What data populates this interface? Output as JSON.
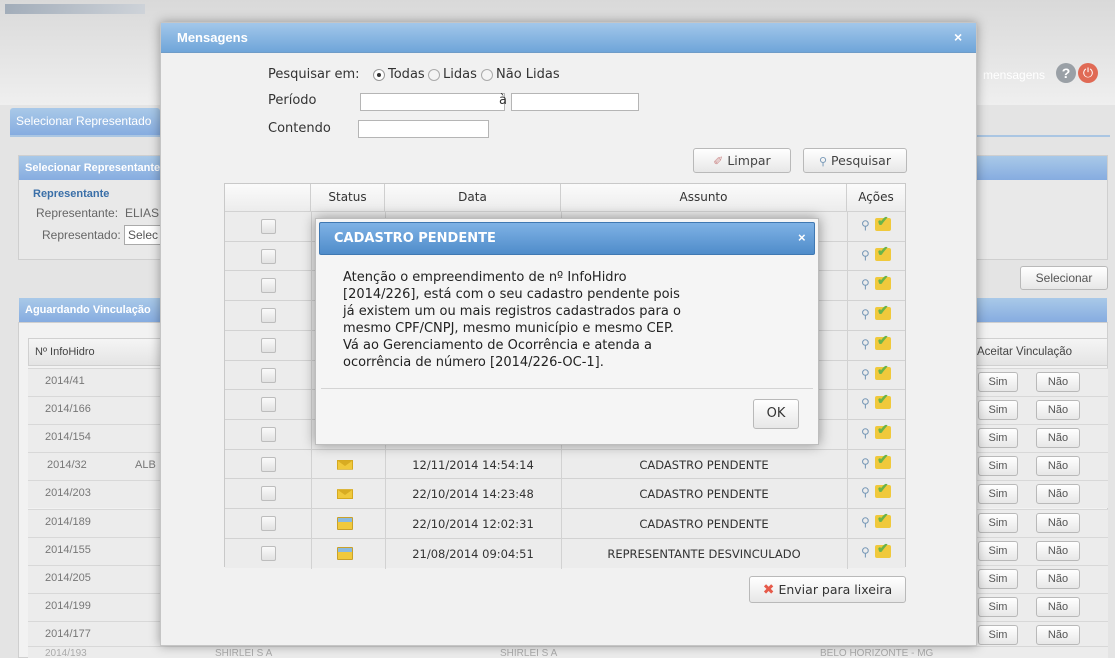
{
  "background": {
    "tab_select": "Selecionar Representado",
    "panel_select_title": "Selecionar Representante",
    "representante_heading": "Representante",
    "representante_label": "Representante:",
    "representante_value": "ELIAS",
    "representado_label": "Representado:",
    "representado_value": "Selec",
    "select_button": "Selecionar",
    "top_right_link": "mensagens",
    "panel_waiting_title": "Aguardando Vinculação",
    "col_infohidro": "Nº InfoHidro",
    "col_aceitar": "Aceitar Vinculação",
    "sim": "Sim",
    "nao": "Não",
    "rows": [
      {
        "id": "2014/41",
        "name": ""
      },
      {
        "id": "2014/166",
        "name": ""
      },
      {
        "id": "2014/154",
        "name": ""
      },
      {
        "id": "2014/32",
        "name": "ALB"
      },
      {
        "id": "2014/203",
        "name": ""
      },
      {
        "id": "2014/189",
        "name": ""
      },
      {
        "id": "2014/155",
        "name": ""
      },
      {
        "id": "2014/205",
        "name": ""
      },
      {
        "id": "2014/199",
        "name": ""
      },
      {
        "id": "2014/177",
        "name": ""
      }
    ],
    "last_row": {
      "id": "2014/193",
      "c1": "SHIRLEI S A",
      "c2": "SHIRLEI S A",
      "c3": "BELO HORIZONTE - MG"
    }
  },
  "modal": {
    "title": "Mensagens",
    "search_in_label": "Pesquisar em:",
    "radio_all": "Todas",
    "radio_read": "Lidas",
    "radio_unread": "Não Lidas",
    "period_label": "Período",
    "period_sep": "à",
    "contains_label": "Contendo",
    "clear_button": "Limpar",
    "search_button": "Pesquisar",
    "trash_button": "Enviar para lixeira",
    "columns": [
      "Status",
      "Data",
      "Assunto",
      "Ações"
    ],
    "rows": [
      {
        "status": "",
        "date": "",
        "subject": ""
      },
      {
        "status": "",
        "date": "",
        "subject": ""
      },
      {
        "status": "",
        "date": "",
        "subject": ""
      },
      {
        "status": "",
        "date": "",
        "subject": ""
      },
      {
        "status": "",
        "date": "",
        "subject": ""
      },
      {
        "status": "",
        "date": "",
        "subject": ""
      },
      {
        "status": "",
        "date": "",
        "subject": ""
      },
      {
        "status": "",
        "date": "",
        "subject": ""
      },
      {
        "status": "unread",
        "date": "12/11/2014 14:54:14",
        "subject": "CADASTRO PENDENTE"
      },
      {
        "status": "unread",
        "date": "22/10/2014 14:23:48",
        "subject": "CADASTRO PENDENTE"
      },
      {
        "status": "read",
        "date": "22/10/2014 12:02:31",
        "subject": "CADASTRO PENDENTE"
      },
      {
        "status": "read",
        "date": "21/08/2014 09:04:51",
        "subject": "REPRESENTANTE DESVINCULADO"
      }
    ]
  },
  "dialog": {
    "title": "CADASTRO PENDENTE",
    "lines": [
      "Atenção o empreendimento de nº InfoHidro",
      "[2014/226], está com o seu cadastro pendente pois",
      "já existem um ou mais registros cadastrados para o",
      "mesmo CPF/CNPJ, mesmo município e mesmo CEP.",
      "Vá ao Gerenciamento de Ocorrência e atenda a",
      "ocorrência de número [2014/226-OC-1]."
    ],
    "ok_button": "OK"
  },
  "colors": {
    "accent": "#6fa5d9",
    "dialog_header": "#4f8cca",
    "close_red": "#e65a4a",
    "envelope_unread": "#f0c93c"
  }
}
